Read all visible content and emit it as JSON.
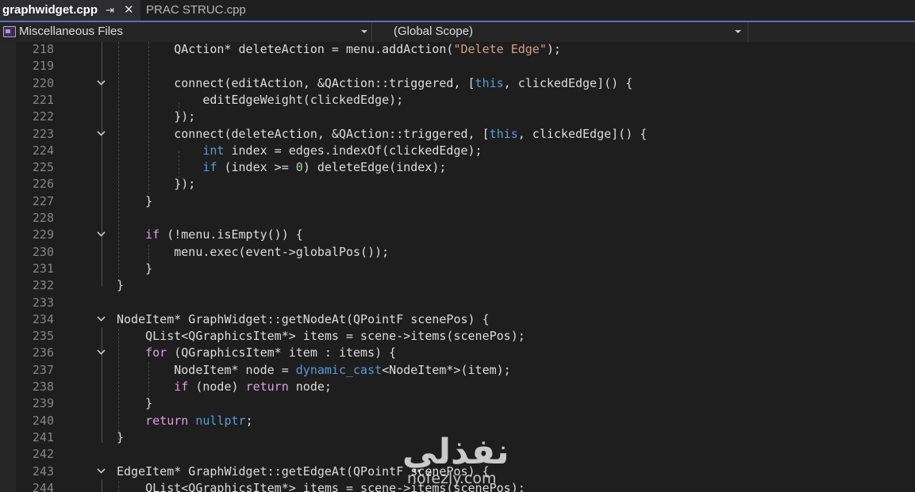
{
  "tabs": {
    "active": {
      "title": "graphwidget.cpp",
      "pin_glyph": "⇥",
      "close_glyph": "✕"
    },
    "inactive": {
      "title": "PRAC STRUC.cpp"
    }
  },
  "navbar": {
    "project": "Miscellaneous Files",
    "scope": "(Global Scope)"
  },
  "editor": {
    "lines": [
      {
        "num": "218",
        "fold": false,
        "tokens": [
          [
            "p",
            "        QAction* deleteAction = menu.addAction("
          ],
          [
            "s",
            "\"Delete Edge\""
          ],
          [
            "p",
            ");"
          ]
        ]
      },
      {
        "num": "219",
        "fold": false,
        "tokens": []
      },
      {
        "num": "220",
        "fold": true,
        "tokens": [
          [
            "p",
            "        connect(editAction, &QAction::triggered, ["
          ],
          [
            "k",
            "this"
          ],
          [
            "p",
            ", clickedEdge]() {"
          ]
        ]
      },
      {
        "num": "221",
        "fold": false,
        "tokens": [
          [
            "p",
            "            editEdgeWeight(clickedEdge);"
          ]
        ]
      },
      {
        "num": "222",
        "fold": false,
        "tokens": [
          [
            "p",
            "        });"
          ]
        ]
      },
      {
        "num": "223",
        "fold": true,
        "tokens": [
          [
            "p",
            "        connect(deleteAction, &QAction::triggered, ["
          ],
          [
            "k",
            "this"
          ],
          [
            "p",
            ", clickedEdge]() {"
          ]
        ]
      },
      {
        "num": "224",
        "fold": false,
        "tokens": [
          [
            "p",
            "            "
          ],
          [
            "k",
            "int"
          ],
          [
            "p",
            " index = edges.indexOf(clickedEdge);"
          ]
        ]
      },
      {
        "num": "225",
        "fold": false,
        "tokens": [
          [
            "p",
            "            "
          ],
          [
            "k",
            "if"
          ],
          [
            "p",
            " (index >= "
          ],
          [
            "n",
            "0"
          ],
          [
            "p",
            ") deleteEdge(index);"
          ]
        ]
      },
      {
        "num": "226",
        "fold": false,
        "tokens": [
          [
            "p",
            "        });"
          ]
        ]
      },
      {
        "num": "227",
        "fold": false,
        "tokens": [
          [
            "p",
            "    }"
          ]
        ]
      },
      {
        "num": "228",
        "fold": false,
        "tokens": []
      },
      {
        "num": "229",
        "fold": true,
        "tokens": [
          [
            "p",
            "    "
          ],
          [
            "c",
            "if"
          ],
          [
            "p",
            " (!menu.isEmpty()) {"
          ]
        ]
      },
      {
        "num": "230",
        "fold": false,
        "tokens": [
          [
            "p",
            "        menu.exec(event->globalPos());"
          ]
        ]
      },
      {
        "num": "231",
        "fold": false,
        "tokens": [
          [
            "p",
            "    }"
          ]
        ]
      },
      {
        "num": "232",
        "fold": false,
        "tokens": [
          [
            "p",
            "}"
          ]
        ]
      },
      {
        "num": "233",
        "fold": false,
        "tokens": []
      },
      {
        "num": "234",
        "fold": true,
        "tokens": [
          [
            "p",
            "NodeItem* GraphWidget::getNodeAt(QPointF scenePos) {"
          ]
        ]
      },
      {
        "num": "235",
        "fold": false,
        "tokens": [
          [
            "p",
            "    QList<QGraphicsItem*> items = scene->items(scenePos);"
          ]
        ]
      },
      {
        "num": "236",
        "fold": true,
        "tokens": [
          [
            "p",
            "    "
          ],
          [
            "c",
            "for"
          ],
          [
            "p",
            " (QGraphicsItem* item : items) {"
          ]
        ]
      },
      {
        "num": "237",
        "fold": false,
        "tokens": [
          [
            "p",
            "        NodeItem* node = "
          ],
          [
            "k",
            "dynamic_cast"
          ],
          [
            "p",
            "<NodeItem*>(item);"
          ]
        ]
      },
      {
        "num": "238",
        "fold": false,
        "tokens": [
          [
            "p",
            "        "
          ],
          [
            "c",
            "if"
          ],
          [
            "p",
            " (node) "
          ],
          [
            "c",
            "return"
          ],
          [
            "p",
            " node;"
          ]
        ]
      },
      {
        "num": "239",
        "fold": false,
        "tokens": [
          [
            "p",
            "    }"
          ]
        ]
      },
      {
        "num": "240",
        "fold": false,
        "tokens": [
          [
            "p",
            "    "
          ],
          [
            "c",
            "return"
          ],
          [
            "p",
            " "
          ],
          [
            "k",
            "nullptr"
          ],
          [
            "p",
            ";"
          ]
        ]
      },
      {
        "num": "241",
        "fold": false,
        "tokens": [
          [
            "p",
            "}"
          ]
        ]
      },
      {
        "num": "242",
        "fold": false,
        "tokens": []
      },
      {
        "num": "243",
        "fold": true,
        "tokens": [
          [
            "p",
            "EdgeItem* GraphWidget::getEdgeAt(QPointF scenePos) {"
          ]
        ]
      },
      {
        "num": "244",
        "fold": false,
        "tokens": [
          [
            "p",
            "    QList<QGraphicsItem*> items = scene->items(scenePos);"
          ]
        ]
      }
    ]
  },
  "watermark": {
    "arabic": "نفذلي",
    "url": "nofezly.com"
  },
  "colors": {
    "keyword": "#569cd6",
    "control": "#d8a0df",
    "string": "#d69d85",
    "number": "#b5cea8",
    "text": "#dcdcdc",
    "line_number": "#858585"
  }
}
